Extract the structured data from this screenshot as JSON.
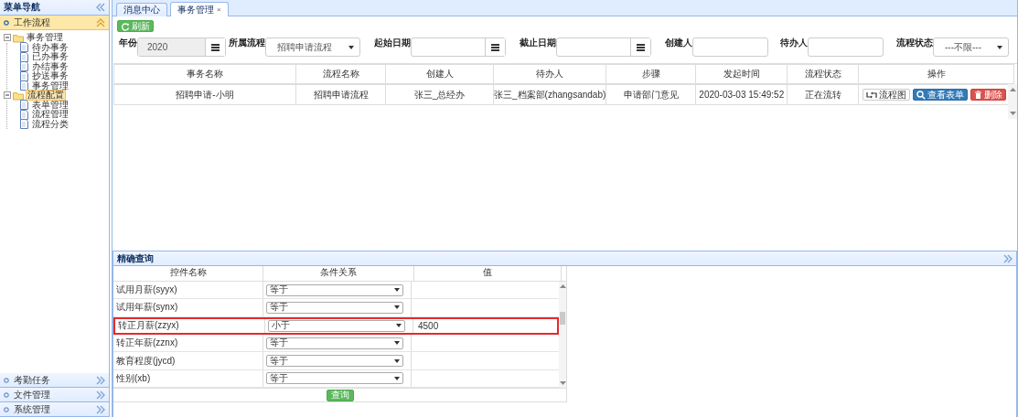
{
  "sidebar": {
    "title": "菜单导航",
    "sections": [
      {
        "label": "工作流程",
        "expanded": true,
        "tree": [
          {
            "label": "事务管理",
            "expanded": true,
            "selected": false,
            "children": [
              {
                "label": "待办事务",
                "selected": false
              },
              {
                "label": "已办事务",
                "selected": false
              },
              {
                "label": "办结事务",
                "selected": false
              },
              {
                "label": "抄送事务",
                "selected": false
              },
              {
                "label": "事务管理",
                "selected": false
              }
            ]
          },
          {
            "label": "流程配置",
            "expanded": true,
            "selected": true,
            "children": [
              {
                "label": "表单管理",
                "selected": false
              },
              {
                "label": "流程管理",
                "selected": false
              },
              {
                "label": "流程分类",
                "selected": false
              }
            ]
          }
        ]
      },
      {
        "label": "考勤任务",
        "expanded": false
      },
      {
        "label": "文件管理",
        "expanded": false
      },
      {
        "label": "系统管理",
        "expanded": false
      }
    ]
  },
  "tabs": [
    {
      "label": "消息中心",
      "selected": false
    },
    {
      "label": "事务管理",
      "selected": true,
      "close": "×"
    }
  ],
  "toolbar": {
    "refresh_button": "刷新"
  },
  "filters": [
    {
      "kind": "date",
      "label": "年份",
      "value": "2020",
      "disabled": true
    },
    {
      "kind": "select",
      "label": "所属流程",
      "value": "招聘申请流程"
    },
    {
      "kind": "date",
      "label": "起始日期",
      "disabled": false
    },
    {
      "kind": "date",
      "label": "截止日期",
      "disabled": false
    },
    {
      "kind": "text",
      "label": "创建人"
    },
    {
      "kind": "text",
      "label": "待办人"
    },
    {
      "kind": "select",
      "label": "流程状态",
      "value": "---不限---"
    }
  ],
  "grid": {
    "columns": [
      "事务名称",
      "流程名称",
      "创建人",
      "待办人",
      "步骤",
      "发起时间",
      "流程状态",
      "操作"
    ],
    "rows": [
      {
        "cells": [
          "招聘申请-小明",
          "招聘申请流程",
          "张三_总经办",
          "张三_档案部(zhangsandab)",
          "申请部门意见",
          "2020-03-03 15:49:52",
          "正在流转"
        ],
        "actions": [
          {
            "kind": "diagram",
            "label": "流程图"
          },
          {
            "kind": "view",
            "label": "查看表单"
          },
          {
            "kind": "delete",
            "label": "删除"
          }
        ]
      }
    ]
  },
  "query": {
    "title": "精确查询",
    "columns": [
      "控件名称",
      "条件关系",
      "值"
    ],
    "rows": [
      {
        "field": "试用月薪(syyx)",
        "relation": "等于",
        "highlighted": false
      },
      {
        "field": "试用年薪(synx)",
        "relation": "等于",
        "highlighted": false
      },
      {
        "field": "转正月薪(zzyx)",
        "relation": "小于",
        "value": "4500",
        "highlighted": true
      },
      {
        "field": "转正年薪(zznx)",
        "relation": "等于",
        "highlighted": false
      },
      {
        "field": "教育程度(jycd)",
        "relation": "等于",
        "highlighted": false
      },
      {
        "field": "性别(xb)",
        "relation": "等于",
        "highlighted": false
      }
    ],
    "button": "查询"
  }
}
